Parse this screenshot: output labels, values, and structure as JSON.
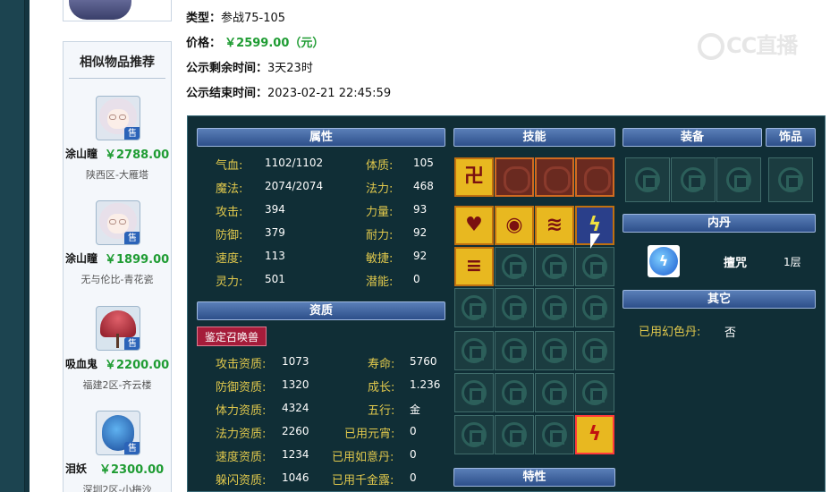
{
  "info": {
    "type_label": "类型：",
    "type_value": "参战75-105",
    "price_label": "价格：",
    "price_value": "￥2599.00（元）",
    "remaining_label": "公示剩余时间：",
    "remaining_value": "3天23时",
    "end_label": "公示结束时间：",
    "end_value": "2023-02-21 22:45:59"
  },
  "watermark": "CC直播",
  "sidebar": {
    "title": "相似物品推荐",
    "sale_badge": "售",
    "items": [
      {
        "name": "涂山瞳",
        "price": "￥2788.00",
        "server": "陕西区-大雁塔"
      },
      {
        "name": "涂山瞳",
        "price": "￥1899.00",
        "server": "无与伦比-青花瓷"
      },
      {
        "name": "吸血鬼",
        "price": "￥2200.00",
        "server": "福建2区-齐云楼"
      },
      {
        "name": "泪妖",
        "price": "￥2300.00",
        "server": "深圳2区-小梅沙"
      }
    ]
  },
  "panel": {
    "attr_header": "属性",
    "attrs_left": [
      {
        "label": "气血:",
        "value": "1102/1102"
      },
      {
        "label": "魔法:",
        "value": "2074/2074"
      },
      {
        "label": "攻击:",
        "value": "394"
      },
      {
        "label": "防御:",
        "value": "379"
      },
      {
        "label": "速度:",
        "value": "113"
      },
      {
        "label": "灵力:",
        "value": "501"
      }
    ],
    "attrs_right": [
      {
        "label": "体质:",
        "value": "105"
      },
      {
        "label": "法力:",
        "value": "468"
      },
      {
        "label": "力量:",
        "value": "93"
      },
      {
        "label": "耐力:",
        "value": "92"
      },
      {
        "label": "敏捷:",
        "value": "92"
      },
      {
        "label": "潜能:",
        "value": "0"
      }
    ],
    "aptitude_header": "资质",
    "identify_button": "鉴定召唤兽",
    "apt_left": [
      {
        "label": "攻击资质:",
        "value": "1073"
      },
      {
        "label": "防御资质:",
        "value": "1320"
      },
      {
        "label": "体力资质:",
        "value": "4324"
      },
      {
        "label": "法力资质:",
        "value": "2260"
      },
      {
        "label": "速度资质:",
        "value": "1234"
      },
      {
        "label": "躲闪资质:",
        "value": "1046"
      }
    ],
    "apt_right": [
      {
        "label": "寿命:",
        "value": "5760"
      },
      {
        "label": "成长:",
        "value": "1.236"
      },
      {
        "label": "五行:",
        "value": "金"
      },
      {
        "label": "已用元宵:",
        "value": "0"
      },
      {
        "label": "已用如意丹:",
        "value": "0"
      },
      {
        "label": "已用千金露:",
        "value": "0"
      }
    ],
    "skills_header": "技能",
    "equip_header": "装备",
    "ornament_header": "饰品",
    "neidan_header": "内丹",
    "neidan_name": "擅咒",
    "neidan_level": "1层",
    "other_header": "其它",
    "huanse_label": "已用幻色丹:",
    "huanse_value": "否",
    "traits_header": "特性"
  },
  "colors": {
    "price_green": "#1f9c33",
    "label_gold": "#e0c84c",
    "panel_bg": "#102e36",
    "header_blue": "#3a5fa0"
  }
}
